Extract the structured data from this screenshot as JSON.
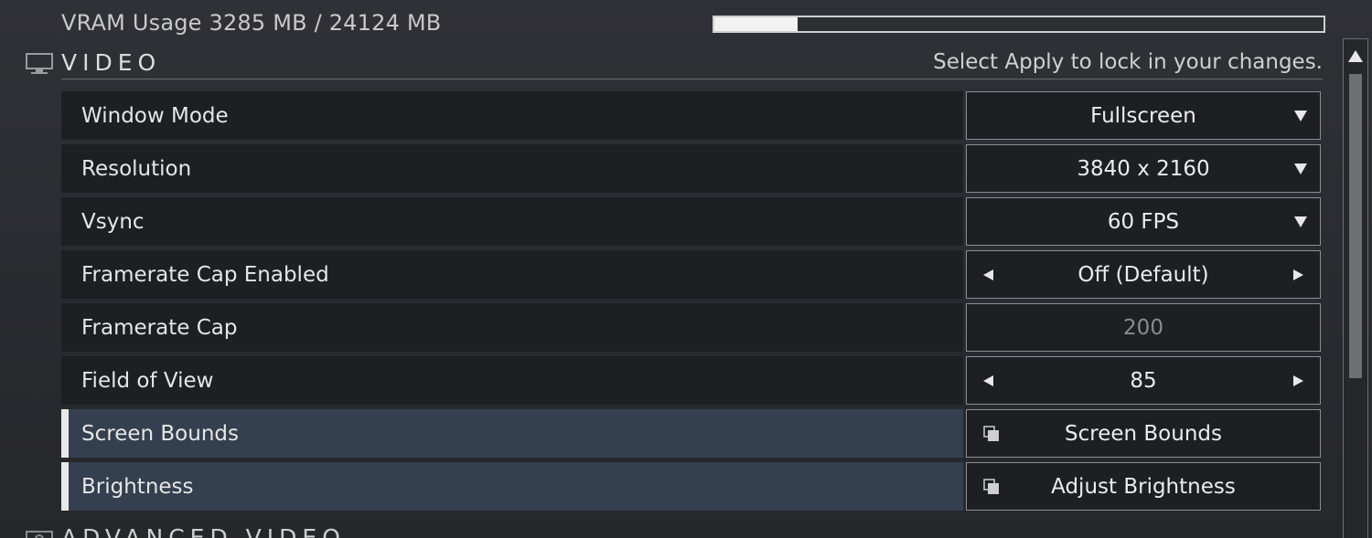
{
  "vram": {
    "label": "VRAM Usage 3285 MB / 24124 MB",
    "used_mb": 3285,
    "total_mb": 24124,
    "fill_fraction": 0.1362
  },
  "section": {
    "icon": "monitor-icon",
    "title": "VIDEO",
    "hint": "Select Apply to lock in your changes."
  },
  "rows": [
    {
      "label": "Window Mode",
      "value": "Fullscreen",
      "control": "dropdown"
    },
    {
      "label": "Resolution",
      "value": "3840 x 2160",
      "control": "dropdown"
    },
    {
      "label": "Vsync",
      "value": "60 FPS",
      "control": "dropdown"
    },
    {
      "label": "Framerate Cap Enabled",
      "value": "Off (Default)",
      "control": "stepper"
    },
    {
      "label": "Framerate Cap",
      "value": "200",
      "control": "disabled-field"
    },
    {
      "label": "Field of View",
      "value": "85",
      "control": "stepper"
    },
    {
      "label": "Screen Bounds",
      "value": "Screen Bounds",
      "control": "external-button"
    },
    {
      "label": "Brightness",
      "value": "Adjust Brightness",
      "control": "external-button"
    }
  ],
  "next_section": {
    "icon": "advanced-video-icon",
    "title": "ADVANCED VIDEO"
  },
  "colors": {
    "background": "#2a2b30",
    "row_bg": "#1e1f23",
    "row_highlight_bg": "#34404f",
    "control_border": "#8d8e93",
    "text": "#e6e6e6"
  }
}
